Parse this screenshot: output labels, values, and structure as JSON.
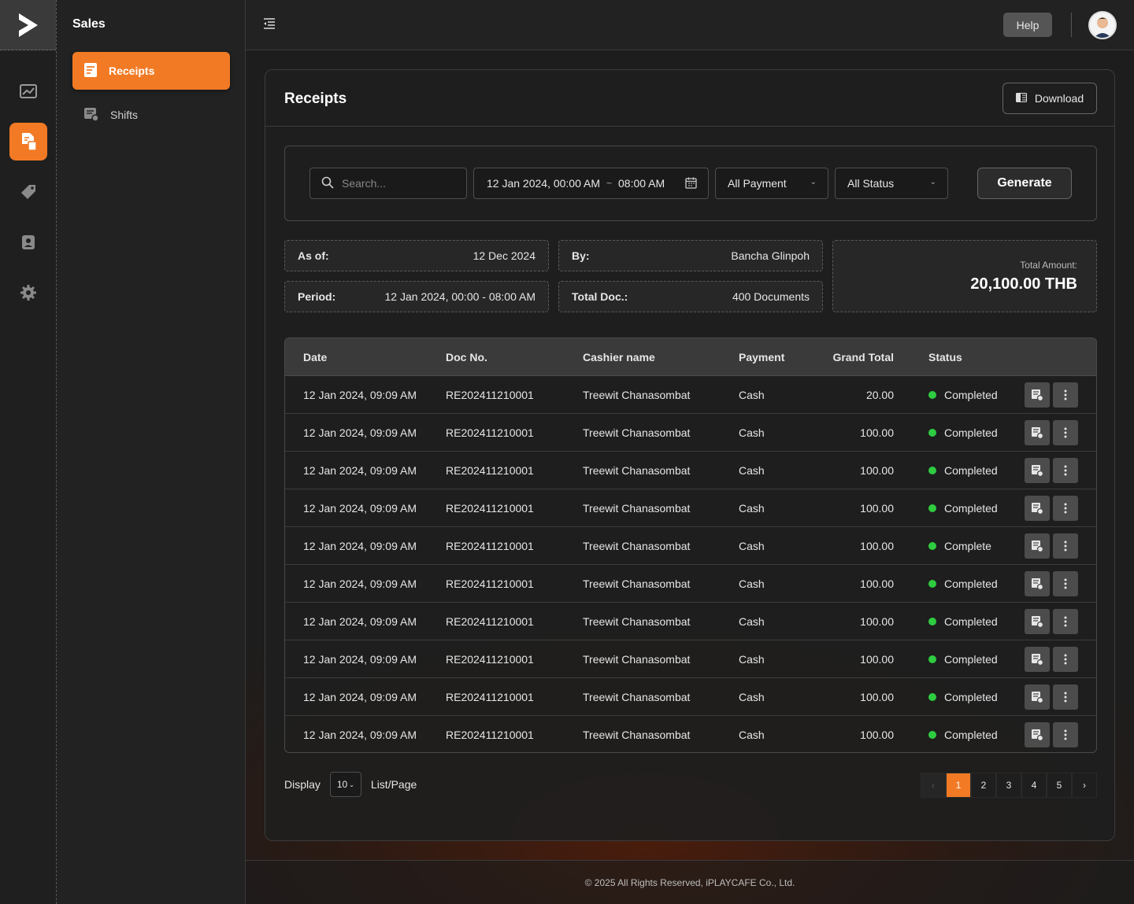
{
  "sidebar": {
    "section_title": "Sales",
    "items": [
      {
        "label": "Receipts",
        "icon": "receipt-icon"
      },
      {
        "label": "Shifts",
        "icon": "shift-icon"
      }
    ]
  },
  "rail": {
    "icons": [
      "logo-icon",
      "chart-icon",
      "document-icon",
      "tag-icon",
      "user-icon",
      "gear-icon"
    ]
  },
  "topbar": {
    "help_label": "Help"
  },
  "page": {
    "title": "Receipts",
    "download_label": "Download"
  },
  "filters": {
    "search_placeholder": "Search...",
    "date_from": "12 Jan 2024, 00:00 AM",
    "date_sep": "~",
    "date_to": "08:00 AM",
    "payment": "All Payment",
    "status": "All Status",
    "generate_label": "Generate"
  },
  "summary": {
    "as_of_label": "As of:",
    "as_of_value": "12 Dec 2024",
    "by_label": "By:",
    "by_value": "Bancha Glinpoh",
    "period_label": "Period:",
    "period_value": "12 Jan 2024, 00:00 - 08:00 AM",
    "total_doc_label": "Total Doc.:",
    "total_doc_value": "400 Documents",
    "total_amount_label": "Total Amount:",
    "total_amount_value": "20,100.00 THB"
  },
  "table": {
    "columns": [
      "Date",
      "Doc No.",
      "Cashier name",
      "Payment",
      "Grand Total",
      "Status"
    ],
    "rows": [
      {
        "date": "12 Jan 2024, 09:09 AM",
        "doc": "RE202411210001",
        "cashier": "Treewit Chanasombat",
        "payment": "Cash",
        "total": "20.00",
        "status": "Completed"
      },
      {
        "date": "12 Jan 2024, 09:09 AM",
        "doc": "RE202411210001",
        "cashier": "Treewit Chanasombat",
        "payment": "Cash",
        "total": "100.00",
        "status": "Completed"
      },
      {
        "date": "12 Jan 2024, 09:09 AM",
        "doc": "RE202411210001",
        "cashier": "Treewit Chanasombat",
        "payment": "Cash",
        "total": "100.00",
        "status": "Completed"
      },
      {
        "date": "12 Jan 2024, 09:09 AM",
        "doc": "RE202411210001",
        "cashier": "Treewit Chanasombat",
        "payment": "Cash",
        "total": "100.00",
        "status": "Completed"
      },
      {
        "date": "12 Jan 2024, 09:09 AM",
        "doc": "RE202411210001",
        "cashier": "Treewit Chanasombat",
        "payment": "Cash",
        "total": "100.00",
        "status": "Complete"
      },
      {
        "date": "12 Jan 2024, 09:09 AM",
        "doc": "RE202411210001",
        "cashier": "Treewit Chanasombat",
        "payment": "Cash",
        "total": "100.00",
        "status": "Completed"
      },
      {
        "date": "12 Jan 2024, 09:09 AM",
        "doc": "RE202411210001",
        "cashier": "Treewit Chanasombat",
        "payment": "Cash",
        "total": "100.00",
        "status": "Completed"
      },
      {
        "date": "12 Jan 2024, 09:09 AM",
        "doc": "RE202411210001",
        "cashier": "Treewit Chanasombat",
        "payment": "Cash",
        "total": "100.00",
        "status": "Completed"
      },
      {
        "date": "12 Jan 2024, 09:09 AM",
        "doc": "RE202411210001",
        "cashier": "Treewit Chanasombat",
        "payment": "Cash",
        "total": "100.00",
        "status": "Completed"
      },
      {
        "date": "12 Jan 2024, 09:09 AM",
        "doc": "RE202411210001",
        "cashier": "Treewit Chanasombat",
        "payment": "Cash",
        "total": "100.00",
        "status": "Completed"
      }
    ]
  },
  "pagination": {
    "display_label": "Display",
    "page_size": "10",
    "per_page_label": "List/Page",
    "pages": [
      "1",
      "2",
      "3",
      "4",
      "5"
    ],
    "current": "1"
  },
  "footer": {
    "copyright": "© 2025 All Rights Reserved, iPLAYCAFE Co., Ltd."
  },
  "colors": {
    "accent": "#f27a25",
    "status_ok": "#2ecc40"
  }
}
